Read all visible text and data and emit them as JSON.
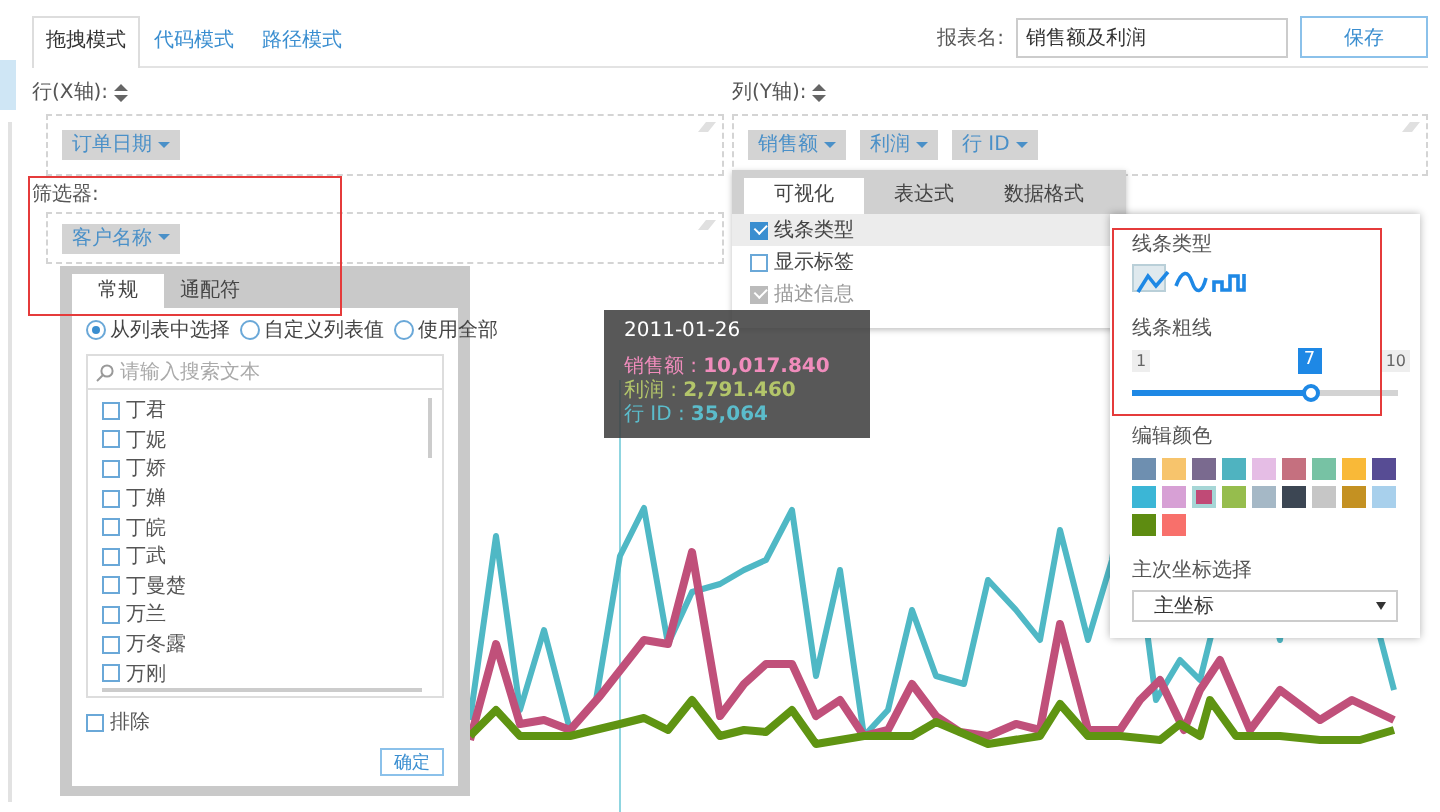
{
  "tabs": [
    {
      "label": "拖拽模式",
      "selected": true
    },
    {
      "label": "代码模式",
      "selected": false
    },
    {
      "label": "路径模式",
      "selected": false
    }
  ],
  "report_name": {
    "label": "报表名:",
    "value": "销售额及利润"
  },
  "save_button": "保存",
  "x_axis": {
    "label": "行(X轴):",
    "fields": [
      "订单日期"
    ]
  },
  "filter": {
    "label": "筛选器:",
    "fields": [
      "客户名称"
    ],
    "highlighted": true
  },
  "y_axis": {
    "label": "列(Y轴):",
    "fields": [
      "销售额",
      "利润",
      "行 ID"
    ]
  },
  "filter_popup": {
    "tabs": [
      {
        "label": "常规",
        "selected": true
      },
      {
        "label": "通配符",
        "selected": false
      }
    ],
    "modes": [
      {
        "label": "从列表中选择",
        "selected": true
      },
      {
        "label": "自定义列表值",
        "selected": false
      },
      {
        "label": "使用全部",
        "selected": false
      }
    ],
    "search": {
      "placeholder": "请输入搜索文本"
    },
    "items": [
      {
        "label": "丁君",
        "checked": false
      },
      {
        "label": "丁妮",
        "checked": false
      },
      {
        "label": "丁娇",
        "checked": false
      },
      {
        "label": "丁婵",
        "checked": false
      },
      {
        "label": "丁皖",
        "checked": false
      },
      {
        "label": "丁武",
        "checked": false
      },
      {
        "label": "丁曼楚",
        "checked": false
      },
      {
        "label": "万兰",
        "checked": false
      },
      {
        "label": "万冬露",
        "checked": false
      },
      {
        "label": "万刚",
        "checked": false
      }
    ],
    "exclude": {
      "label": "排除",
      "checked": false
    },
    "ok_button": "确定"
  },
  "series_popup": {
    "tabs": [
      {
        "label": "可视化",
        "selected": true
      },
      {
        "label": "表达式",
        "selected": false
      },
      {
        "label": "数据格式",
        "selected": false
      }
    ],
    "options": [
      {
        "label": "线条类型",
        "checked": true,
        "selected": true,
        "disabled": false
      },
      {
        "label": "显示标签",
        "checked": false,
        "selected": false,
        "disabled": false
      },
      {
        "label": "描述信息",
        "checked": true,
        "selected": false,
        "disabled": true
      }
    ]
  },
  "tooltip": {
    "date": "2011-01-26",
    "rows": [
      {
        "label": "销售额 :",
        "value": "10,017.840",
        "color": "#f08cbc"
      },
      {
        "label": "利润 :",
        "value": "2,791.460",
        "color": "#b3c56a"
      },
      {
        "label": "行 ID :",
        "value": "35,064",
        "color": "#5bbccb"
      }
    ]
  },
  "line_options": {
    "highlighted": true,
    "type_label": "线条类型",
    "types": [
      {
        "kind": "polyline",
        "selected": true
      },
      {
        "kind": "curve",
        "selected": false
      },
      {
        "kind": "step",
        "selected": false
      }
    ],
    "width_label": "线条粗线",
    "width_min": "1",
    "width_max": "10",
    "width_value": "7",
    "level": 0.667,
    "color_label": "编辑颜色",
    "swatches": [
      {
        "color": "#6e8fb0",
        "selected": false
      },
      {
        "color": "#f7c46c",
        "selected": false
      },
      {
        "color": "#7a6a8f",
        "selected": false
      },
      {
        "color": "#4fb3c0",
        "selected": false
      },
      {
        "color": "#e5bde5",
        "selected": false
      },
      {
        "color": "#c5707f",
        "selected": false
      },
      {
        "color": "#77c2a4",
        "selected": false
      },
      {
        "color": "#f9b938",
        "selected": false
      },
      {
        "color": "#574c94",
        "selected": false
      },
      {
        "color": "#3bb6d6",
        "selected": false
      },
      {
        "color": "#d7a0d5",
        "selected": false
      },
      {
        "color": "#c04a76",
        "selected": true
      },
      {
        "color": "#96bd4d",
        "selected": false
      },
      {
        "color": "#a5b8c6",
        "selected": false
      },
      {
        "color": "#3c4653",
        "selected": false
      },
      {
        "color": "#c6c6c6",
        "selected": false
      },
      {
        "color": "#c49122",
        "selected": false
      },
      {
        "color": "#a8d0ec",
        "selected": false
      },
      {
        "color": "#5e8c11",
        "selected": false
      },
      {
        "color": "#f8706b",
        "selected": false
      }
    ],
    "axis_label": "主次坐标选择",
    "axis_value": "主坐标"
  }
}
